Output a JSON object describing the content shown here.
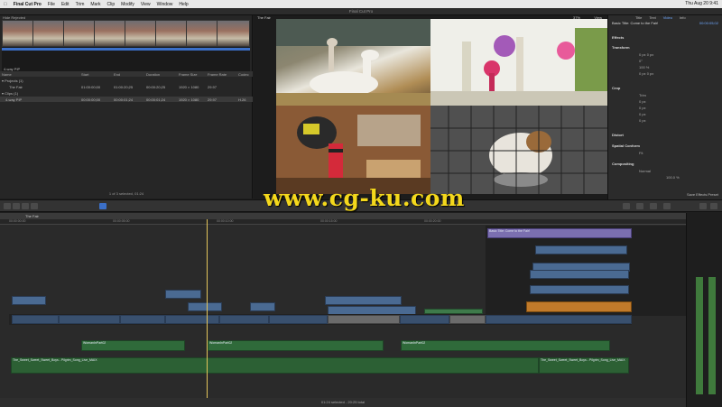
{
  "menubar": {
    "app_name": "Final Cut Pro",
    "items": [
      "File",
      "Edit",
      "Trim",
      "Mark",
      "Clip",
      "Modify",
      "View",
      "Window",
      "Help"
    ],
    "clock": "Thu Aug 20 9:41"
  },
  "window": {
    "title": "Final Cut Pro"
  },
  "browser": {
    "filter_label": "Hide Rejected",
    "thumb_caption": "4-way PIP",
    "columns": [
      "Name",
      "Start",
      "End",
      "Duration",
      "Frame Size",
      "Frame Rate",
      "Codec"
    ],
    "groups": [
      {
        "label": "Projects",
        "count": "1"
      },
      {
        "label": "Clips",
        "count": "1"
      }
    ],
    "rows": [
      {
        "name": "The Fair",
        "start": "01:00:00;00",
        "end": "01:00:20;25",
        "duration": "00:00:20;25",
        "frame_size": "1920 × 1080",
        "frame_rate": "29.97",
        "codec": ""
      },
      {
        "name": "4-way PIP",
        "start": "00:00:00;00",
        "end": "00:00:01;24",
        "duration": "00:00:01;24",
        "frame_size": "1920 × 1080",
        "frame_rate": "29.97",
        "codec": "H.26"
      }
    ],
    "footer": "1 of 3 selected, 01:24"
  },
  "viewer": {
    "title": "The Fair",
    "zoom": "37%",
    "view_label": "View"
  },
  "inspector": {
    "tabs": [
      "Title",
      "Text",
      "Video",
      "Info"
    ],
    "clip_title": "Basic Title: Come to the Fair!",
    "clip_duration": "00:00:05;02",
    "sections": [
      "Effects",
      "Transform",
      "Crop",
      "Distort",
      "Spatial Conform",
      "Compositing"
    ],
    "transform": {
      "position_x": "0 px",
      "position_y": "0 px",
      "rotation": "0°",
      "scale": "100 %",
      "anchor_x": "0 px",
      "anchor_y": "0 px"
    },
    "crop": {
      "type": "Trim",
      "left": "0 px",
      "right": "0 px",
      "top": "0 px",
      "bottom": "0 px"
    },
    "spatial_type": "Fit",
    "blend_mode": "Normal",
    "opacity": "100.0 %",
    "save_label": "Save Effects Preset"
  },
  "timeline": {
    "project": "The Fair",
    "ruler_ticks": [
      "00:00:00:00",
      "00:00:05:00",
      "00:00:10:00",
      "00:00:15:00",
      "00:00:20:00"
    ],
    "titles": [
      "Basic Title: Come to the Fair!"
    ],
    "audio_clips": [
      "WomanInPart02",
      "WomanInPart02",
      "WomanInPart02"
    ],
    "music_clip": "The_Sweet_Sweet_Sweet_Boys - Pilgrim_Song_Live_MAIX",
    "music_clip_2": "The_Sweet_Sweet_Sweet_Boys - Pilgrim_Song_Live_MAIX",
    "status": "01:24 selected - 20:25 total"
  },
  "watermark": "www.cg-ku.com",
  "colors": {
    "accent": "#f4d81c",
    "playhead": "#e3c45c",
    "video_clip": "#4a6a92",
    "title_clip": "#7b6fb0",
    "audio_clip": "#2f6a3a"
  }
}
